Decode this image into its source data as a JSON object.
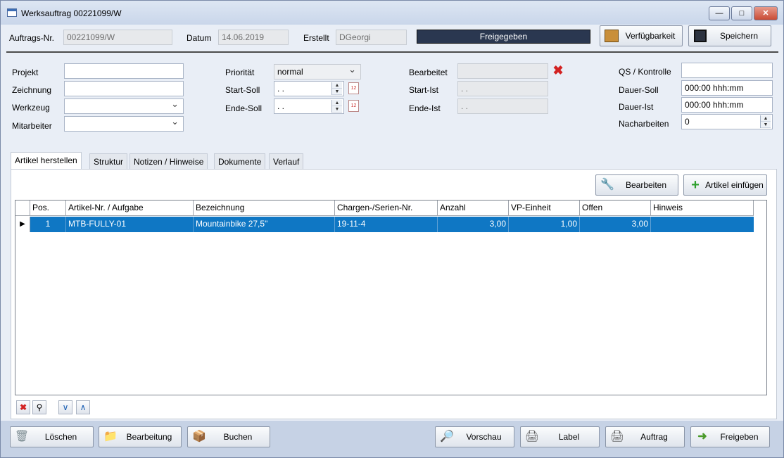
{
  "window": {
    "title": "Werksauftrag 00221099/W",
    "min_label": "—",
    "max_label": "□",
    "close_label": "✕"
  },
  "header": {
    "order_label": "Auftrags-Nr.",
    "order_value": "00221099/W",
    "date_label": "Datum",
    "date_value": "14.06.2019",
    "created_label": "Erstellt",
    "created_value": "DGeorgi",
    "status": "Freigegeben",
    "availability_button": "Verfügbarkeit",
    "save_button": "Speichern"
  },
  "form": {
    "project_label": "Projekt",
    "project_value": "",
    "drawing_label": "Zeichnung",
    "drawing_value": "",
    "tool_label": "Werkzeug",
    "tool_value": "",
    "employee_label": "Mitarbeiter",
    "employee_value": "",
    "priority_label": "Priorität",
    "priority_value": "normal",
    "start_target_label": "Start-Soll",
    "start_target_value": " .  .",
    "end_target_label": "Ende-Soll",
    "end_target_value": " .  .",
    "edited_label": "Bearbeitet",
    "edited_value": "",
    "start_actual_label": "Start-Ist",
    "start_actual_value": " .  .",
    "end_actual_label": "Ende-Ist",
    "end_actual_value": " .  .",
    "qa_label": "QS / Kontrolle",
    "qa_value": "",
    "duration_target_label": "Dauer-Soll",
    "duration_target_value": "000:00 hhh:mm",
    "duration_actual_label": "Dauer-Ist",
    "duration_actual_value": "000:00 hhh:mm",
    "rework_label": "Nacharbeiten",
    "rework_value": "0",
    "calendar_glyph": "12"
  },
  "tabs": [
    "Artikel herstellen",
    "Struktur",
    "Notizen / Hinweise",
    "Dokumente",
    "Verlauf"
  ],
  "panel": {
    "edit_button": "Bearbeiten",
    "insert_button": "Artikel einfügen"
  },
  "grid": {
    "columns": [
      "Pos.",
      "Artikel-Nr. / Aufgabe",
      "Bezeichnung",
      "Chargen-/Serien-Nr.",
      "Anzahl",
      "VP-Einheit",
      "Offen",
      "Hinweis"
    ],
    "rows": [
      {
        "indicator": "▶",
        "pos": "1",
        "article": "MTB-FULLY-01",
        "description": "Mountainbike 27,5\"",
        "batch": "19-11-4",
        "quantity": "3,00",
        "unit_price": "1,00",
        "open": "3,00",
        "note": ""
      }
    ]
  },
  "bottom": {
    "delete": "Löschen",
    "processing": "Bearbeitung",
    "book": "Buchen",
    "preview": "Vorschau",
    "label": "Label",
    "order": "Auftrag",
    "release": "Freigeben"
  },
  "colors": {
    "status_bg": "#2a3750",
    "selection": "#0f77c4",
    "bottom_bar": "#c6d2e5",
    "delete_red": "#d32222"
  },
  "icons": [
    "window-icon",
    "availability-icon",
    "save-disk-icon",
    "clear-x-icon",
    "calendar-icon",
    "wrench-icon",
    "plus-icon",
    "delete-x-icon",
    "magnifier-icon",
    "chevron-down-icon",
    "chevron-up-icon",
    "trash-icon",
    "folder-icon",
    "box-icon",
    "preview-icon",
    "printer-icon",
    "release-arrow-icon"
  ]
}
